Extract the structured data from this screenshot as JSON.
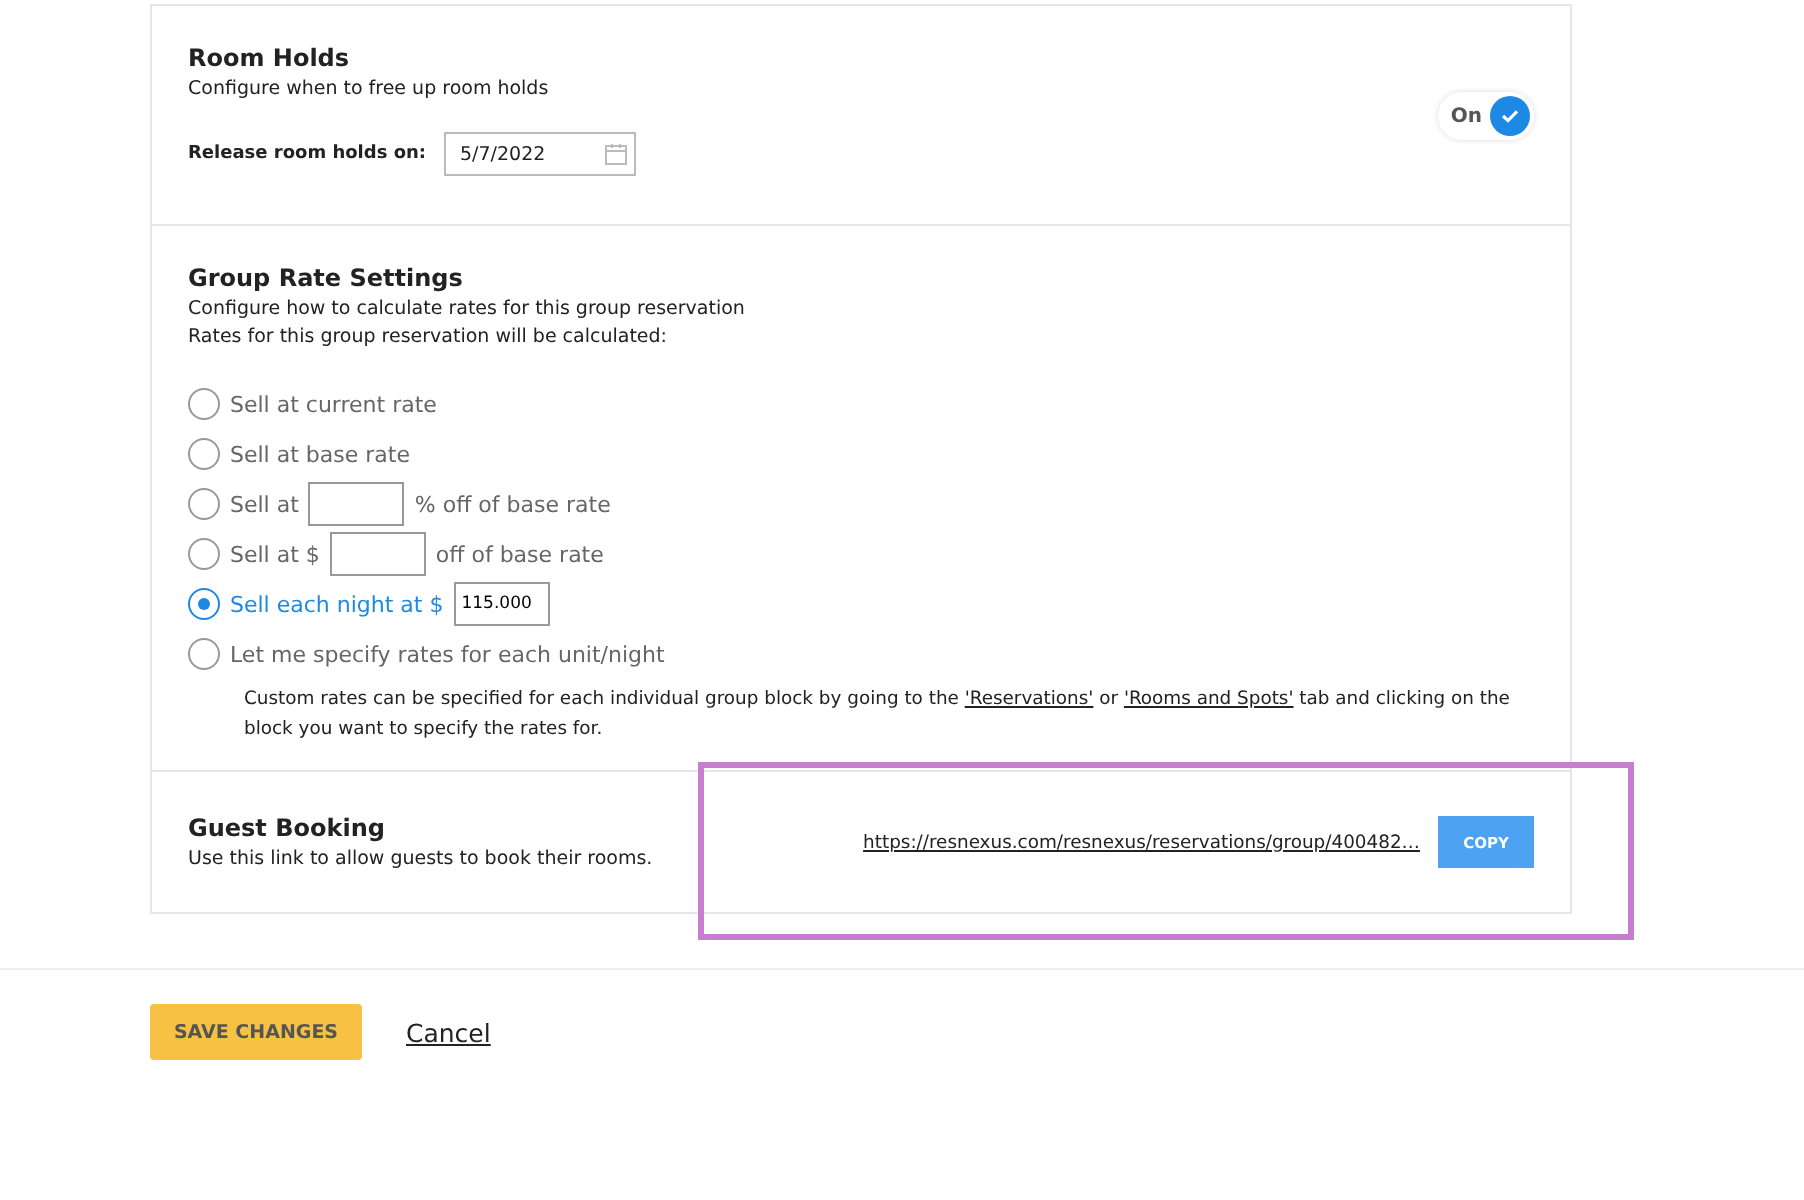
{
  "room_holds": {
    "title": "Room Holds",
    "description": "Configure when to free up room holds",
    "toggle": {
      "label": "On",
      "on": true
    },
    "release_label": "Release room holds on:",
    "release_date": "5/7/2022"
  },
  "group_rate": {
    "title": "Group Rate Settings",
    "description": "Configure how to calculate rates for this group reservation",
    "subtitle": "Rates for this group reservation will be calculated:",
    "options": [
      {
        "label": "Sell at current rate",
        "selected": false
      },
      {
        "label": "Sell at base rate",
        "selected": false
      },
      {
        "label": "Sell at",
        "kind": "input",
        "suffix": "% off of base rate",
        "selected": false
      },
      {
        "label": "Sell at $",
        "kind": "input",
        "suffix": "off of base rate",
        "selected": false
      },
      {
        "label": "Sell each night at $",
        "kind": "input",
        "input": "115.000",
        "selected": true
      },
      {
        "label": "Let me specify rates for each unit/night",
        "selected": false
      }
    ],
    "note": {
      "before": "Custom rates can be specified for each individual group block by going to the ",
      "link_1": "'Reservations'",
      "middle": " or ",
      "link_2": "'Rooms and Spots'",
      "after": " tab and clicking on the block you want to specify the rates for."
    }
  },
  "guest_booking": {
    "title": "Guest Booking",
    "description": "Use this link to allow guests to book their rooms.",
    "link": "https://resnexus.com/resnexus/reservations/group/400482…",
    "copy_button": "COPY"
  },
  "footer": {
    "save_button": "SAVE CHANGES",
    "cancel_link": "Cancel"
  }
}
